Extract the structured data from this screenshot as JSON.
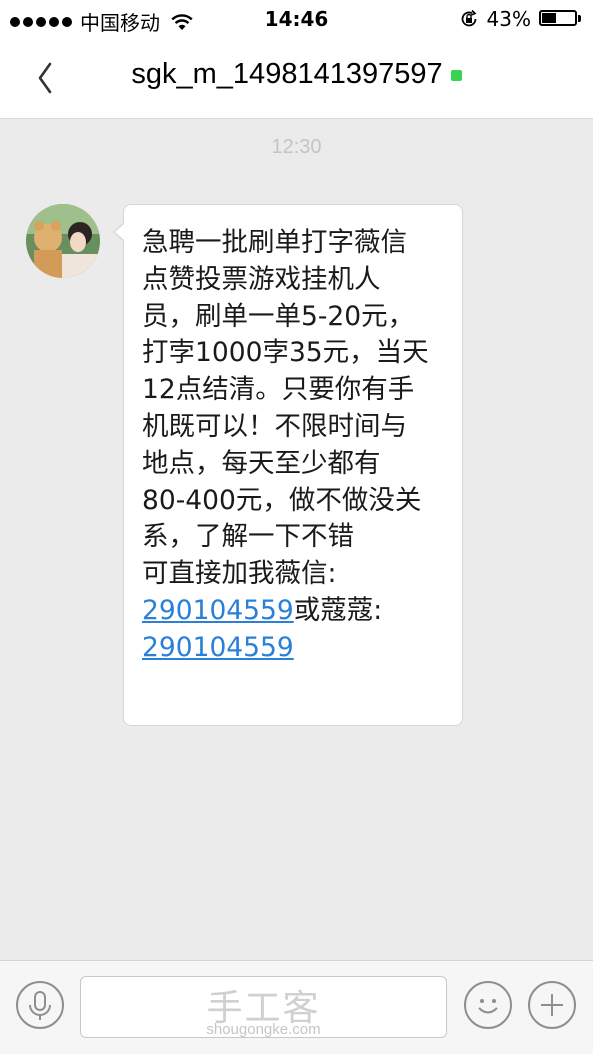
{
  "status_bar": {
    "carrier": "中国移动",
    "time": "14:46",
    "battery_percent": "43%",
    "battery_level": 0.43,
    "icons": [
      "signal-dots-icon",
      "wifi-icon",
      "rotation-lock-icon",
      "battery-icon"
    ]
  },
  "nav": {
    "back_icon": "chevron-left-icon",
    "title": "sgk_m_1498141397597",
    "online_color": "#39d353"
  },
  "conversation": {
    "timestamp": "12:30",
    "message": {
      "lines": [
        "急聘一批刷单打字薇信",
        "点赞投票游戏挂机人",
        "员，刷单一单5-20元，",
        "打孛1000孛35元，当天",
        "12点结清。只要你有手",
        "机既可以！不限时间与",
        "地点，每天至少都有",
        "80-400元，做不做没关",
        "系，了解一下不错",
        "可直接加我薇信:"
      ],
      "link1": "290104559",
      "after_link1": "或蔻蔻:",
      "link2": "290104559"
    }
  },
  "input_bar": {
    "voice_icon": "microphone-icon",
    "emoji_icon": "smiley-icon",
    "add_icon": "plus-icon",
    "watermark_cn": "手工客",
    "watermark_en": "shougongke.com"
  },
  "colors": {
    "link": "#2a80d8",
    "background": "#ebebeb",
    "online": "#39d353"
  }
}
